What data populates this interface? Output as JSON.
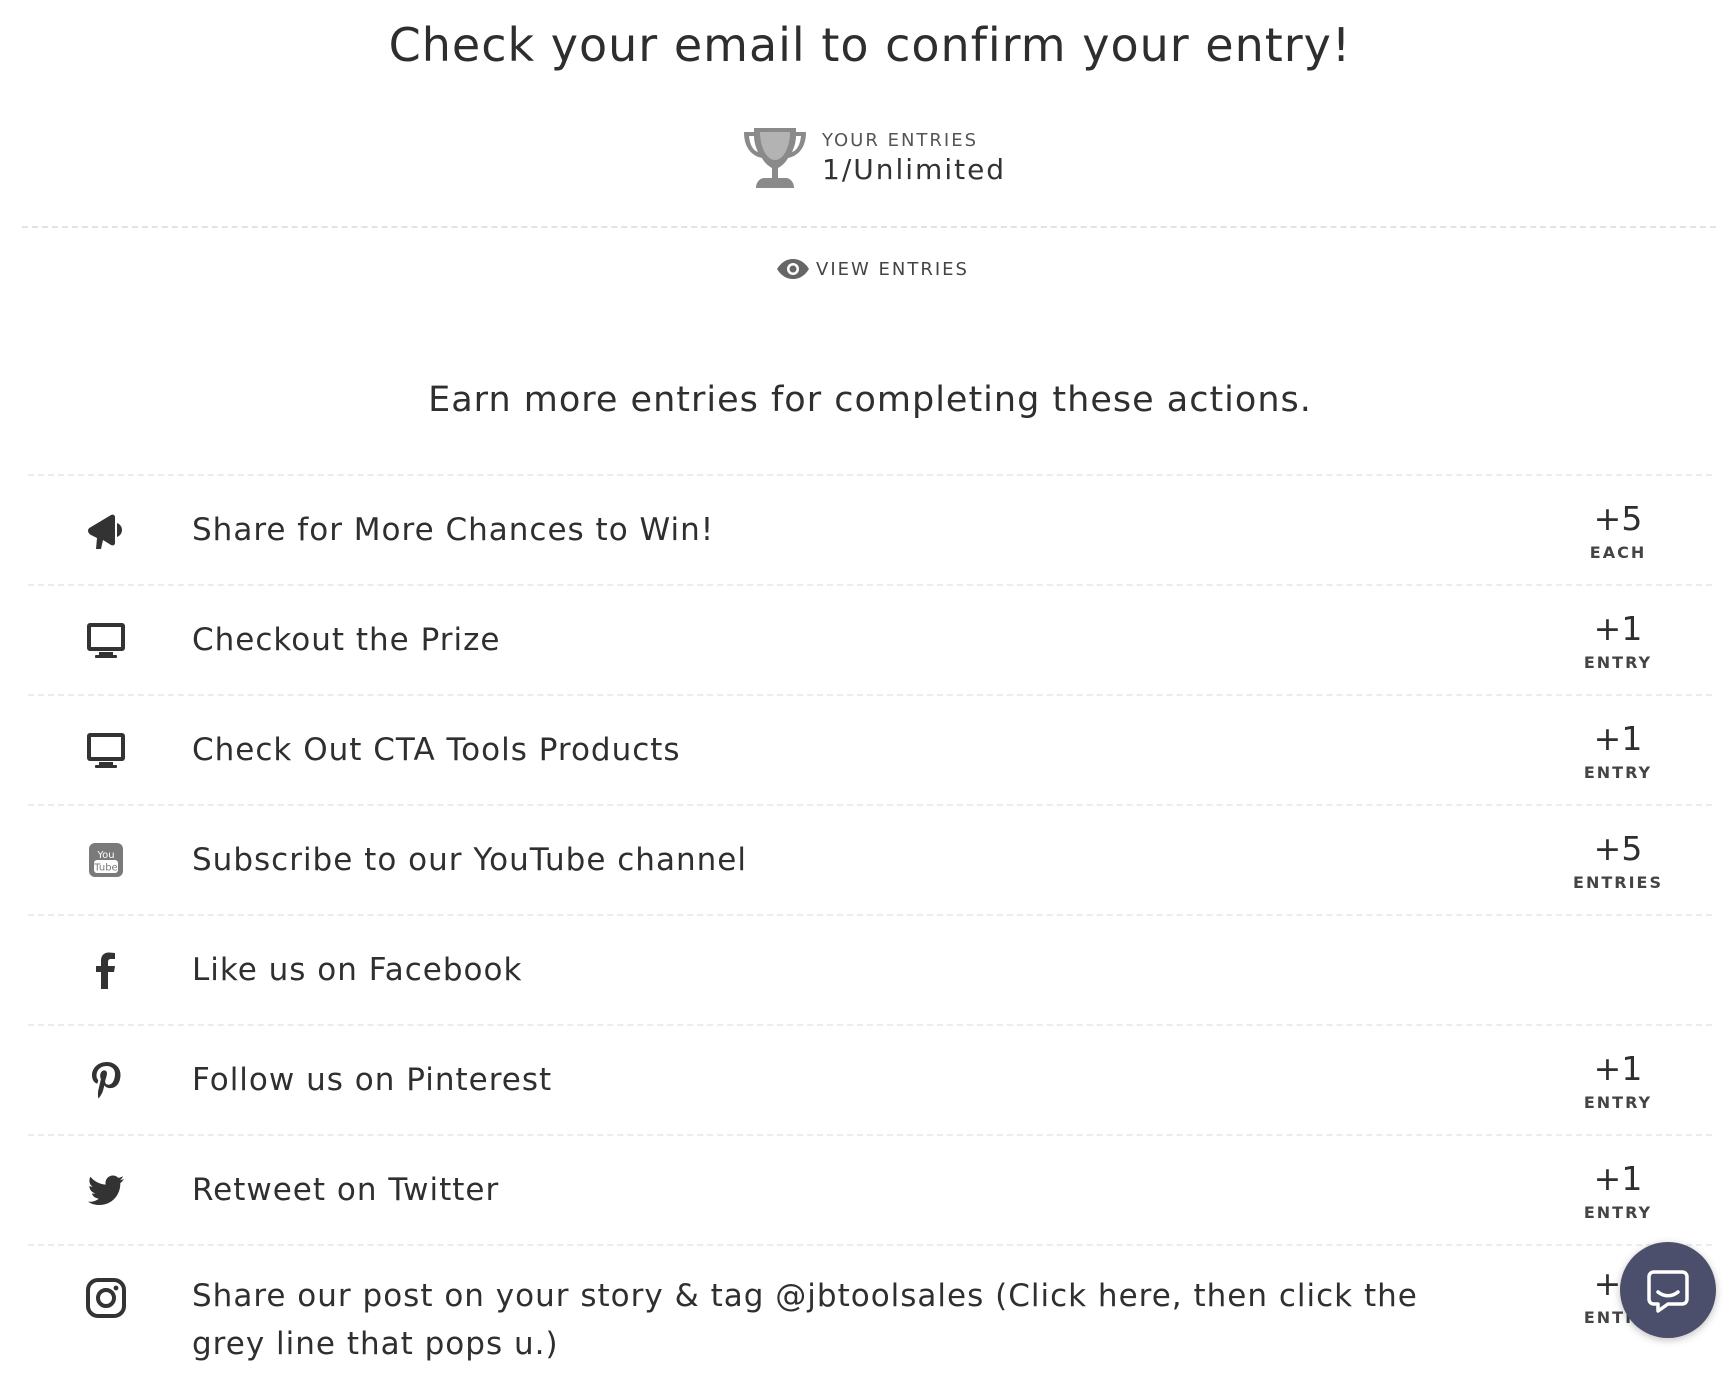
{
  "header": {
    "headline": "Check your email to confirm your entry!",
    "entries_caption": "YOUR ENTRIES",
    "entries_count": "1/Unlimited",
    "view_entries_label": "VIEW ENTRIES"
  },
  "actions_heading": "Earn more entries for completing these actions.",
  "actions": [
    {
      "icon": "megaphone-icon",
      "label": "Share for More Chances to Win!",
      "value": "+5",
      "unit": "EACH"
    },
    {
      "icon": "monitor-icon",
      "label": "Checkout the Prize",
      "value": "+1",
      "unit": "ENTRY"
    },
    {
      "icon": "monitor-icon",
      "label": "Check Out CTA Tools Products",
      "value": "+1",
      "unit": "ENTRY"
    },
    {
      "icon": "youtube-icon",
      "label": "Subscribe to our YouTube channel",
      "value": "+5",
      "unit": "ENTRIES"
    },
    {
      "icon": "facebook-icon",
      "label": "Like us on Facebook",
      "value": "",
      "unit": ""
    },
    {
      "icon": "pinterest-icon",
      "label": "Follow us on Pinterest",
      "value": "+1",
      "unit": "ENTRY"
    },
    {
      "icon": "twitter-icon",
      "label": "Retweet on Twitter",
      "value": "+1",
      "unit": "ENTRY"
    },
    {
      "icon": "instagram-icon",
      "label": "Share our post on your story & tag @jbtoolsales (Click here, then click the grey line that pops u.)",
      "value": "+1",
      "unit": "ENTRY"
    }
  ],
  "colors": {
    "text": "#2f2f2f",
    "icon_grey": "#777777",
    "divider": "#ececec",
    "chat_button": "#4c4f6b"
  }
}
